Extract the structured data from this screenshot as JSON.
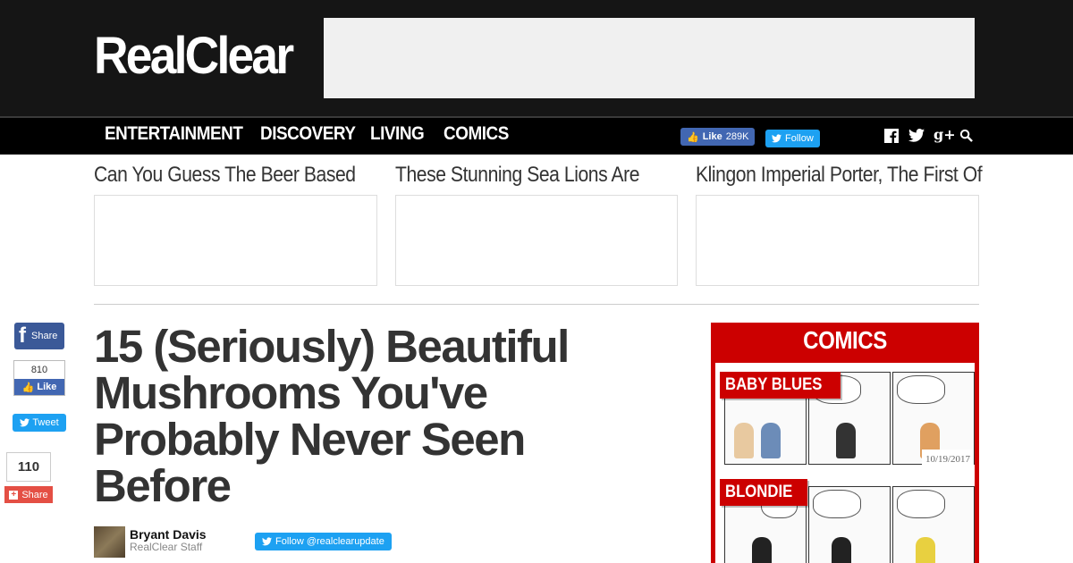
{
  "header": {
    "logo": "RealClear",
    "nav": [
      "ENTERTAINMENT",
      "DISCOVERY",
      "LIVING",
      "COMICS"
    ],
    "fb_like_label": "Like",
    "fb_like_count": "289K",
    "tw_follow_label": "Follow",
    "icons": [
      "facebook-icon",
      "twitter-icon",
      "google-plus-icon",
      "search-icon"
    ]
  },
  "teasers": [
    {
      "title": "Can You Guess The Beer Based"
    },
    {
      "title": "These Stunning Sea Lions Are"
    },
    {
      "title": "Klingon Imperial Porter, The First Of"
    }
  ],
  "share": {
    "fb_share_label": "Share",
    "like_count": "810",
    "like_label": "Like",
    "tweet_label": "Tweet",
    "share_count": "110",
    "share_label": "Share"
  },
  "article": {
    "title": "15 (Seriously) Beautiful Mushrooms You've Probably Never Seen Before",
    "author": "Bryant Davis",
    "author_role": "RealClear Staff",
    "follow_label": "Follow @realclearupdate"
  },
  "comics": {
    "title": "COMICS",
    "items": [
      {
        "name": "BABY BLUES",
        "date": "10/19/2017"
      },
      {
        "name": "BLONDIE"
      }
    ]
  },
  "colors": {
    "header_bg": "#151515",
    "nav_bg": "#000000",
    "comics_red": "#cc0000",
    "facebook": "#4267b2",
    "twitter": "#1da1f2"
  }
}
